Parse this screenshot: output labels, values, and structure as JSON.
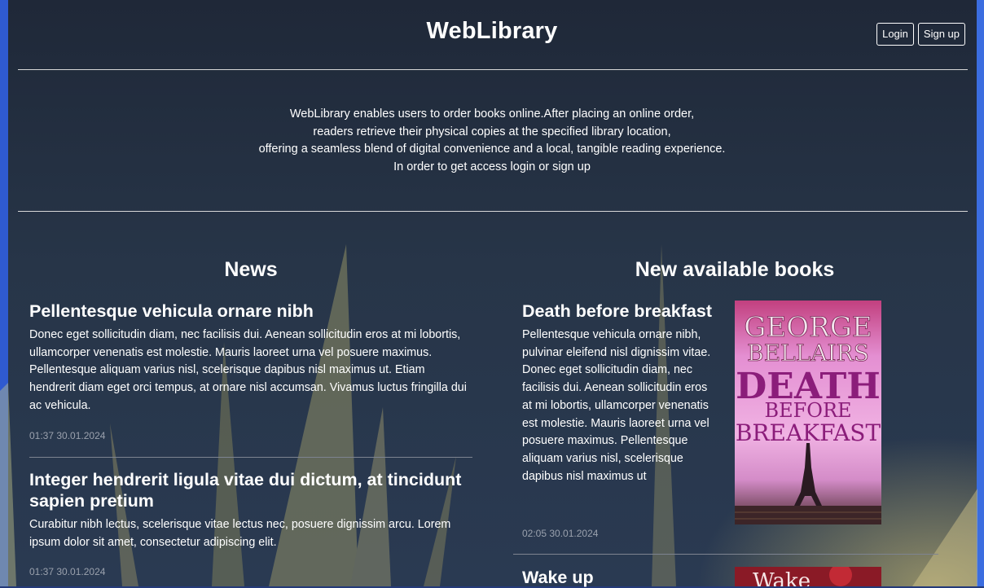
{
  "header": {
    "title": "WebLibrary",
    "login_label": "Login",
    "signup_label": "Sign up"
  },
  "intro": {
    "lines": [
      "WebLibrary enables users to order books online.After placing an online order,",
      "readers retrieve their physical copies at the specified library location,",
      "offering a seamless blend of digital convenience and a local, tangible reading experience.",
      "In order to get access login or sign up"
    ]
  },
  "news": {
    "heading": "News",
    "items": [
      {
        "title": "Pellentesque vehicula ornare nibh",
        "body": "Donec eget sollicitudin diam, nec facilisis dui. Aenean sollicitudin eros at mi lobortis, ullamcorper venenatis est molestie. Mauris laoreet urna vel posuere maximus. Pellentesque aliquam varius nisl, scelerisque dapibus nisl maximus ut. Etiam hendrerit diam eget orci tempus, at ornare nisl accumsan. Vivamus luctus fringilla dui ac vehicula.",
        "time": "01:37 30.01.2024"
      },
      {
        "title": "Integer hendrerit ligula vitae dui dictum, at tincidunt sapien pretium",
        "body": "Curabitur nibh lectus, scelerisque vitae lectus nec, posuere dignissim arcu. Lorem ipsum dolor sit amet, consectetur adipiscing elit.",
        "time": "01:37 30.01.2024"
      }
    ]
  },
  "books": {
    "heading": "New available books",
    "items": [
      {
        "title": "Death before breakfast",
        "body": "Pellentesque vehicula ornare nibh, pulvinar eleifend nisl dignissim vitae. Donec eget sollicitudin diam, nec facilisis dui. Aenean sollicitudin eros at mi lobortis, ullamcorper venenatis est molestie. Mauris laoreet urna vel posuere maximus. Pellentesque aliquam varius nisl, scelerisque dapibus nisl maximus ut",
        "time": "02:05 30.01.2024",
        "cover": {
          "author_line1": "GEORGE",
          "author_line2": "BELLAIRS",
          "title_line1": "DEATH",
          "title_line2": "BEFORE",
          "title_line3": "BREAKFAST"
        }
      },
      {
        "title": "Wake up",
        "cover": {
          "visible_text": "Wake"
        }
      }
    ]
  },
  "colors": {
    "text": "#ffffff",
    "muted": "#9aa1ad",
    "cover_pink": "#e38fd0",
    "cover_title": "#8b1d7a"
  }
}
